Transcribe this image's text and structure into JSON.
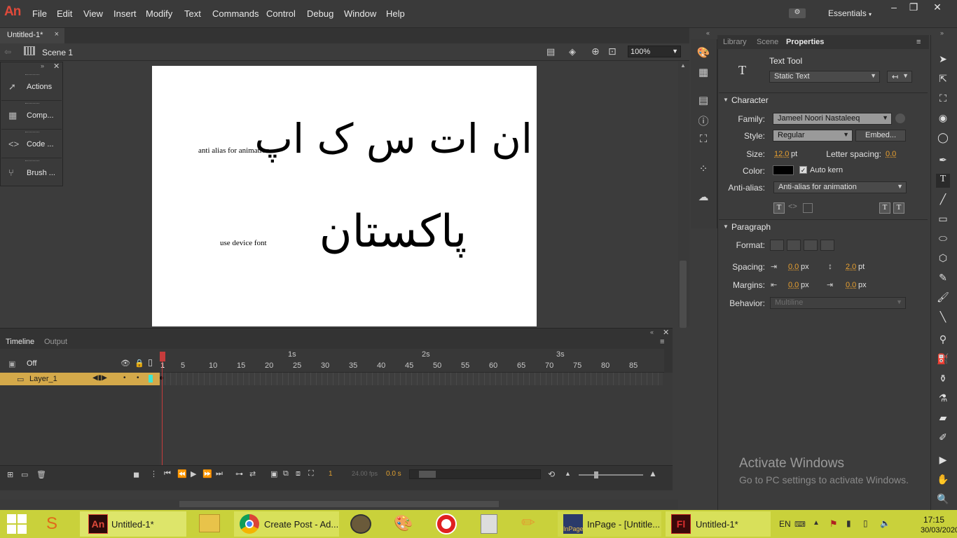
{
  "app": {
    "logo": "An",
    "workspace": "Essentials"
  },
  "menu": [
    "File",
    "Edit",
    "View",
    "Insert",
    "Modify",
    "Text",
    "Commands",
    "Control",
    "Debug",
    "Window",
    "Help"
  ],
  "document": {
    "tab_title": "Untitled-1*",
    "scene": "Scene 1",
    "zoom": "100%"
  },
  "stage": {
    "label_top": "anti alias for animation",
    "label_bottom": "use device font",
    "urdu_top": "ان ات س ک اپ",
    "urdu_bottom": "پاکستان"
  },
  "floating_panel": {
    "items": [
      {
        "label": "Actions",
        "icon": "actions-icon"
      },
      {
        "label": "Comp...",
        "icon": "components-icon"
      },
      {
        "label": "Code ...",
        "icon": "code-snippets-icon"
      },
      {
        "label": "Brush ...",
        "icon": "brush-library-icon"
      }
    ]
  },
  "timeline": {
    "tabs": [
      "Timeline",
      "Output"
    ],
    "onion_label": "Off",
    "layer_name": "Layer_1",
    "frame_ticks": [
      "1",
      "5",
      "10",
      "15",
      "20",
      "25",
      "30",
      "35",
      "40",
      "45",
      "50",
      "55",
      "60",
      "65",
      "70",
      "75",
      "80",
      "85"
    ],
    "second_marks": [
      "1s",
      "2s",
      "3s"
    ],
    "current_frame": "1",
    "fps": "24.00 fps",
    "elapsed": "0.0 s"
  },
  "properties": {
    "tabs": [
      "Library",
      "Scene",
      "Properties"
    ],
    "tool_name": "Text Tool",
    "text_type": "Static Text",
    "character": {
      "heading": "Character",
      "family_label": "Family:",
      "family": "Jameel Noori Nastaleeq",
      "style_label": "Style:",
      "style": "Regular",
      "embed_label": "Embed...",
      "size_label": "Size:",
      "size_value": "12.0",
      "size_unit": "pt",
      "letter_spacing_label": "Letter spacing:",
      "letter_spacing_value": "0.0",
      "color_label": "Color:",
      "color": "#000000",
      "auto_kern_label": "Auto kern",
      "anti_alias_label": "Anti-alias:",
      "anti_alias": "Anti-alias for animation"
    },
    "paragraph": {
      "heading": "Paragraph",
      "format_label": "Format:",
      "spacing_label": "Spacing:",
      "spacing_indent": "0.0",
      "spacing_indent_unit": "px",
      "spacing_line": "2.0",
      "spacing_line_unit": "pt",
      "margins_label": "Margins:",
      "margin_left": "0.0",
      "margin_left_unit": "px",
      "margin_right": "0.0",
      "margin_right_unit": "px",
      "behavior_label": "Behavior:",
      "behavior": "Multiline"
    }
  },
  "watermark": {
    "title": "Activate Windows",
    "subtitle": "Go to PC settings to activate Windows."
  },
  "taskbar": {
    "items": [
      {
        "label": "Untitled-1*",
        "icon": "animate-icon"
      },
      {
        "label": "Create Post - Ad...",
        "icon": "chrome-icon"
      },
      {
        "label": "InPage - [Untitle...",
        "icon": "inpage-icon"
      },
      {
        "label": "Untitled-1*",
        "icon": "flash-icon"
      }
    ],
    "lang": "EN",
    "time": "17:15",
    "date": "30/03/2020"
  },
  "colors": {
    "accent": "#e0a030",
    "layer_highlight": "#d4a94a",
    "taskbar": "#c9d13b",
    "logo": "#e04a3a"
  }
}
